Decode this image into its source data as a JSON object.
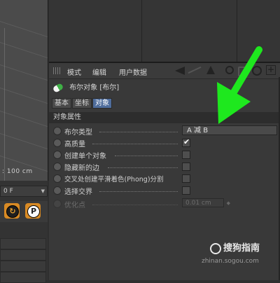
{
  "viewport": {
    "scale_label": ": 100 cm"
  },
  "timeline": {
    "frame_value": "0 F"
  },
  "tools": {
    "p_label": "P"
  },
  "attribute_manager": {
    "menu": {
      "mode": "模式",
      "edit": "编辑",
      "user_data": "用户数据"
    },
    "object_title": "布尔对象 [布尔]",
    "tabs": [
      "基本",
      "坐标",
      "对象"
    ],
    "active_tab": "对象",
    "section_title": "对象属性",
    "properties": [
      {
        "label": "布尔类型",
        "control": "dropdown",
        "value": "A 减 B",
        "enabled": true
      },
      {
        "label": "高质量",
        "control": "checkbox",
        "checked": true,
        "enabled": true
      },
      {
        "label": "创建单个对象",
        "control": "checkbox",
        "checked": false,
        "enabled": true
      },
      {
        "label": "隐藏新的边",
        "control": "checkbox",
        "checked": false,
        "enabled": true
      },
      {
        "label": "交叉处创建平滑着色(Phong)分割",
        "control": "checkbox",
        "checked": false,
        "enabled": true
      },
      {
        "label": "选择交界",
        "control": "checkbox",
        "checked": false,
        "enabled": true
      },
      {
        "label": "优化点",
        "control": "number",
        "value": "0.01 cm",
        "enabled": false
      }
    ]
  },
  "watermark": {
    "brand": "搜狗指南",
    "url": "zhinan.sogou.com"
  },
  "colors": {
    "arrow": "#1ee81e",
    "active_tab": "#4f6d9c",
    "tool_orange": "#d88a24"
  }
}
